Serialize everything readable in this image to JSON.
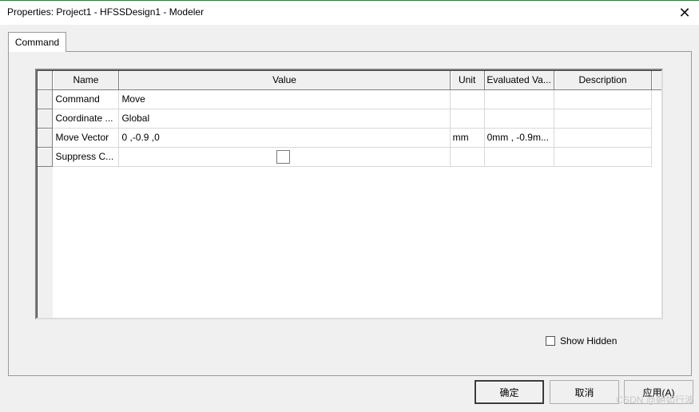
{
  "window": {
    "title": "Properties: Project1 - HFSSDesign1 - Modeler",
    "close_glyph": "✕"
  },
  "tabs": [
    {
      "label": "Command",
      "active": true
    }
  ],
  "grid": {
    "columns": [
      "Name",
      "Value",
      "Unit",
      "Evaluated Va...",
      "Description"
    ],
    "rows": [
      {
        "name": "Command",
        "value": "Move",
        "unit": "",
        "evaluated": "",
        "description": ""
      },
      {
        "name": "Coordinate ...",
        "value": "Global",
        "unit": "",
        "evaluated": "",
        "description": ""
      },
      {
        "name": "Move Vector",
        "value": "0 ,-0.9 ,0",
        "unit": "mm",
        "evaluated": "0mm , -0.9m...",
        "description": ""
      },
      {
        "name": "Suppress C...",
        "value": "",
        "value_checkbox": false,
        "unit": "",
        "evaluated": "",
        "description": ""
      }
    ]
  },
  "show_hidden": {
    "label": "Show Hidden",
    "checked": false
  },
  "buttons": {
    "ok": "确定",
    "cancel": "取消",
    "apply": "应用(A)"
  },
  "watermark": "CSDN @朝如行波",
  "colors": {
    "grid_border": "#808080",
    "panel_bg": "#f0f0f0"
  }
}
